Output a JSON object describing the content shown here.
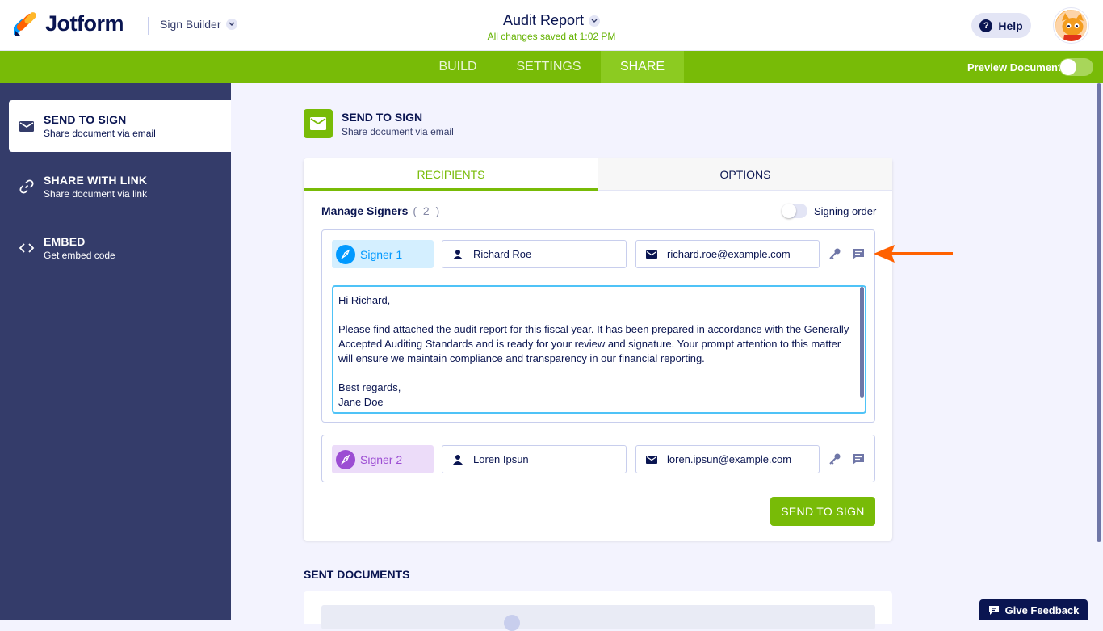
{
  "app": {
    "brand": "Jotform",
    "builder": "Sign Builder",
    "doc_title": "Audit Report",
    "save_status": "All changes saved at 1:02 PM",
    "help": "Help"
  },
  "nav": {
    "tabs": [
      "BUILD",
      "SETTINGS",
      "SHARE"
    ],
    "active_tab": "SHARE",
    "preview_label": "Preview Document"
  },
  "sidebar": {
    "items": [
      {
        "title": "SEND TO SIGN",
        "sub": "Share document via email",
        "icon": "envelope-icon",
        "active": true
      },
      {
        "title": "SHARE WITH LINK",
        "sub": "Share document via link",
        "icon": "link-icon",
        "active": false
      },
      {
        "title": "EMBED",
        "sub": "Get embed code",
        "icon": "code-icon",
        "active": false
      }
    ]
  },
  "main": {
    "title": "SEND TO SIGN",
    "subtitle": "Share document via email",
    "tabs": {
      "recipients": "RECIPIENTS",
      "options": "OPTIONS"
    },
    "manage_label": "Manage Signers",
    "signer_count": "( 2 )",
    "signing_order": "Signing order",
    "signers": [
      {
        "label": "Signer 1",
        "name": "Richard Roe",
        "email": "richard.roe@example.com",
        "badge_bg": "#d4efff",
        "badge_fg": "#0099ff",
        "circle": "#0099ff"
      },
      {
        "label": "Signer 2",
        "name": "Loren Ipsun",
        "email": "loren.ipsun@example.com",
        "badge_bg": "#ecdcf9",
        "badge_fg": "#9c4dd3",
        "circle": "#9c4dd3"
      }
    ],
    "message": "Hi Richard,\n\nPlease find attached the audit report for this fiscal year. It has been prepared in accordance with the Generally Accepted Auditing Standards and is ready for your review and signature. Your prompt attention to this matter will ensure we maintain compliance and transparency in our financial reporting.\n\nBest regards,\nJane Doe",
    "send_button": "SEND TO SIGN",
    "sent_title": "SENT DOCUMENTS"
  },
  "feedback": "Give Feedback",
  "colors": {
    "accent": "#78bb07",
    "navy": "#0a1551",
    "sidebar": "#343c6a",
    "arrow": "#ff6100"
  }
}
